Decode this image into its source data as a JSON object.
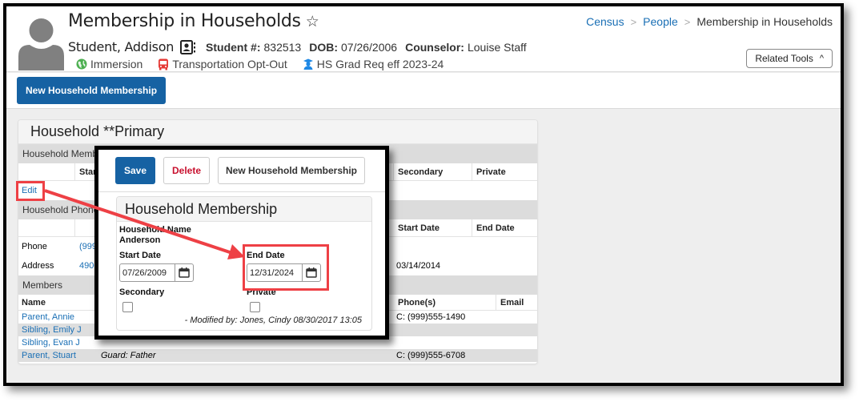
{
  "header": {
    "title": "Membership in Households",
    "student_name": "Student, Addison",
    "student_number_label": "Student #:",
    "student_number": "832513",
    "dob_label": "DOB:",
    "dob": "07/26/2006",
    "counselor_label": "Counselor:",
    "counselor": "Louise Staff",
    "flags": [
      {
        "icon": "globe-icon",
        "label": "Immersion",
        "color": "#4caf50"
      },
      {
        "icon": "bus-icon",
        "label": "Transportation Opt-Out",
        "color": "#e53935"
      },
      {
        "icon": "graduate-icon",
        "label": "HS Grad Req eff 2023-24",
        "color": "#1e88e5"
      }
    ],
    "breadcrumb": [
      "Census",
      "People",
      "Membership in Households"
    ],
    "related_tools_label": "Related Tools"
  },
  "toolbar": {
    "new_household_membership_label": "New Household Membership"
  },
  "panel": {
    "title": "Household **Primary",
    "household_membership": {
      "section_label": "Household Membership",
      "columns": [
        "Start",
        "Secondary",
        "Private"
      ],
      "edit_label": "Edit"
    },
    "household_phone": {
      "section_label": "Household Phone",
      "columns": [
        "Start Date",
        "End Date"
      ],
      "rows": [
        {
          "label": "Phone",
          "value": "(999)",
          "start_date": ""
        },
        {
          "label": "Address",
          "value": "4900",
          "start_date": "03/14/2014"
        }
      ]
    },
    "members": {
      "section_label": "Members",
      "columns": [
        "Name",
        "Phone(s)",
        "Email"
      ],
      "rows": [
        {
          "name": "Parent, Annie",
          "relationship": "",
          "phone": "C:   (999)555-1490"
        },
        {
          "name": "Sibling, Emily J",
          "relationship": "",
          "phone": ""
        },
        {
          "name": "Sibling, Evan J",
          "relationship": "",
          "phone": ""
        },
        {
          "name": "Parent, Stuart",
          "relationship": "Guard: Father",
          "phone": "C:   (999)555-6708"
        }
      ]
    }
  },
  "callout": {
    "save_label": "Save",
    "delete_label": "Delete",
    "new_label": "New Household Membership",
    "card_title": "Household Membership",
    "household_name_label": "Household Name",
    "household_name": "Anderson",
    "start_date_label": "Start Date",
    "start_date": "07/26/2009",
    "end_date_label": "End Date",
    "end_date": "12/31/2024",
    "secondary_label": "Secondary",
    "secondary_checked": false,
    "private_label": "Private",
    "private_checked": false,
    "modified_text": "- Modified by: Jones, Cindy 08/30/2017 13:05"
  },
  "colors": {
    "primary": "#1662a3",
    "link": "#1a6fb5",
    "danger": "#c8102e",
    "annotation": "#ee4045"
  }
}
